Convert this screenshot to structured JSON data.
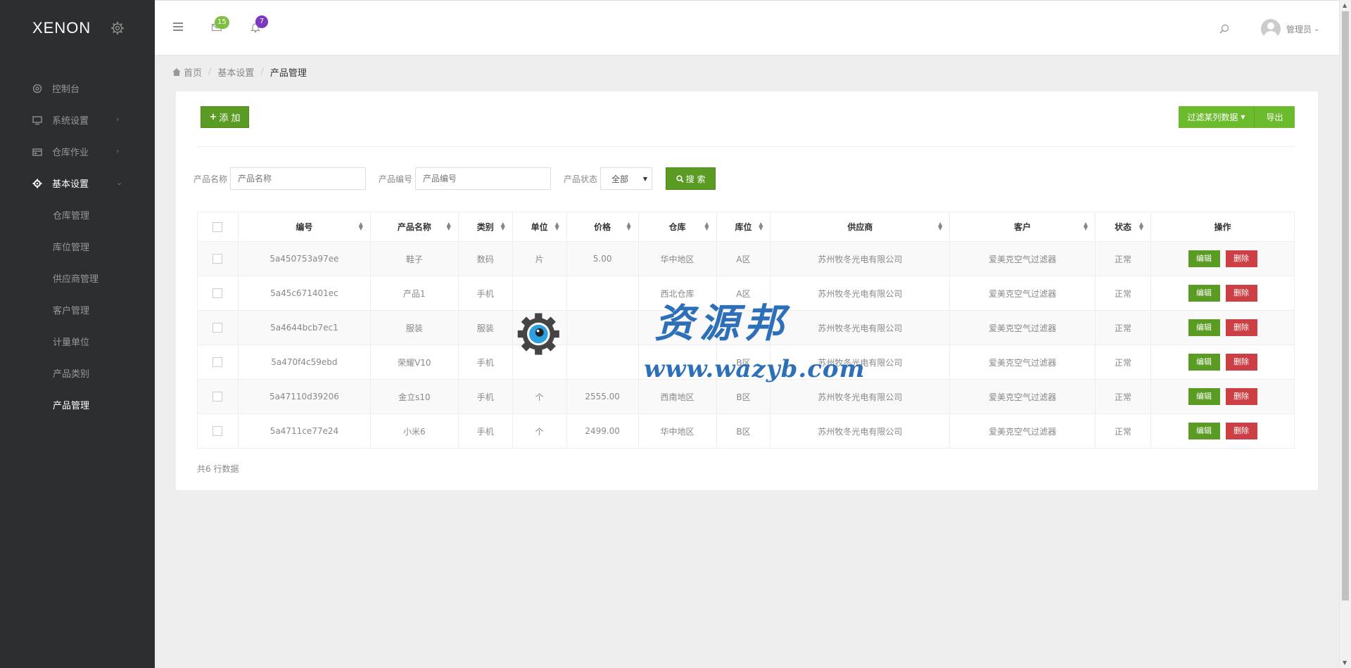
{
  "sidebar": {
    "logo": "XENON",
    "menu": [
      {
        "label": "控制台",
        "icon": "gauge-icon"
      },
      {
        "label": "系统设置",
        "icon": "monitor-icon"
      },
      {
        "label": "仓库作业",
        "icon": "warehouse-icon"
      },
      {
        "label": "基本设置",
        "icon": "cog-icon"
      }
    ],
    "submenu": [
      "仓库管理",
      "库位管理",
      "供应商管理",
      "客户管理",
      "计量单位",
      "产品类别",
      "产品管理"
    ]
  },
  "header": {
    "mail_badge": "15",
    "bell_badge": "7",
    "user_name": "管理员",
    "colors": {
      "mail_badge": "#7fbf3f",
      "bell_badge": "#7c38bc"
    }
  },
  "breadcrumb": [
    "首页",
    "基本设置",
    "产品管理"
  ],
  "toolbar": {
    "add_label": "添 加",
    "filter_label": "过滤某列数据",
    "export_label": "导出"
  },
  "search": {
    "name_label": "产品名称",
    "name_placeholder": "产品名称",
    "code_label": "产品编号",
    "code_placeholder": "产品编号",
    "status_label": "产品状态",
    "status_value": "全部",
    "search_label": "搜 索"
  },
  "table": {
    "columns": [
      "编号",
      "产品名称",
      "类别",
      "单位",
      "价格",
      "仓库",
      "库位",
      "供应商",
      "客户",
      "状态",
      "操作"
    ],
    "rows": [
      [
        "5a450753a97ee",
        "鞋子",
        "数码",
        "片",
        "5.00",
        "华中地区",
        "A区",
        "苏州牧冬光电有限公司",
        "爱美克空气过滤器",
        "正常"
      ],
      [
        "5a45c671401ec",
        "产品1",
        "手机",
        "",
        "",
        "西北仓库",
        "A区",
        "苏州牧冬光电有限公司",
        "爱美克空气过滤器",
        "正常"
      ],
      [
        "5a4644bcb7ec1",
        "服装",
        "服装",
        "",
        "",
        "",
        "",
        "苏州牧冬光电有限公司",
        "爱美克空气过滤器",
        "正常"
      ],
      [
        "5a470f4c59ebd",
        "荣耀V10",
        "手机",
        "",
        "",
        "",
        "B区",
        "苏州牧冬光电有限公司",
        "爱美克空气过滤器",
        "正常"
      ],
      [
        "5a47110d39206",
        "金立s10",
        "手机",
        "个",
        "2555.00",
        "西南地区",
        "B区",
        "苏州牧冬光电有限公司",
        "爱美克空气过滤器",
        "正常"
      ],
      [
        "5a4711ce77e24",
        "小米6",
        "手机",
        "个",
        "2499.00",
        "华中地区",
        "B区",
        "苏州牧冬光电有限公司",
        "爱美克空气过滤器",
        "正常"
      ]
    ],
    "edit_label": "编辑",
    "delete_label": "删除"
  },
  "footer": {
    "total": "共6 行数据"
  },
  "watermark": {
    "title": "资源邦",
    "url": "www.wazyb.com"
  }
}
